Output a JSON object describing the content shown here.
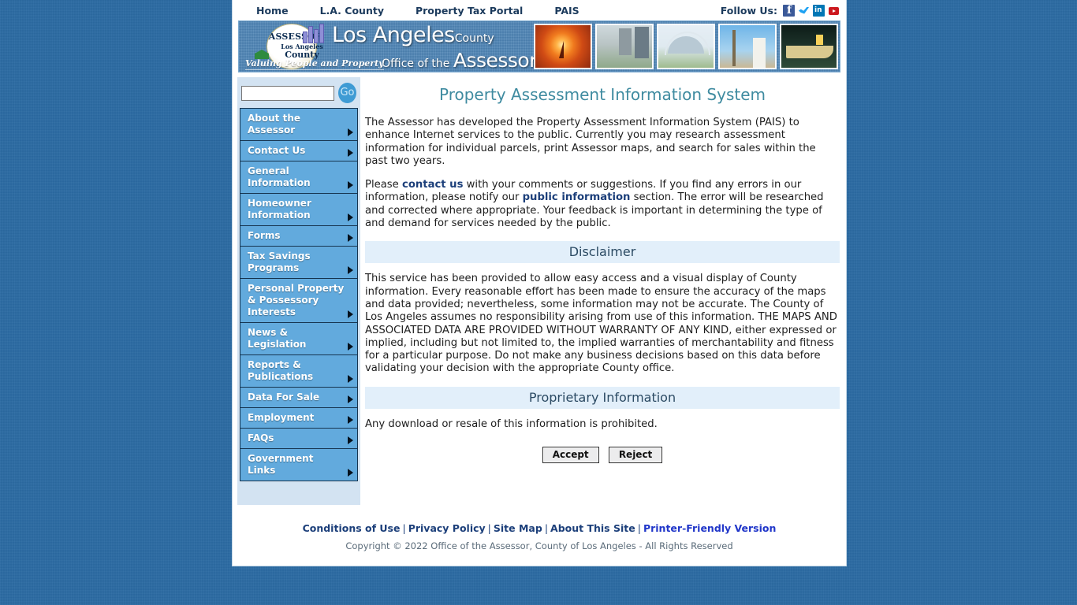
{
  "topnav": {
    "links": [
      {
        "label": "Home",
        "name": "topnav-home"
      },
      {
        "label": "L.A. County",
        "name": "topnav-la-county"
      },
      {
        "label": "Property Tax Portal",
        "name": "topnav-property-tax-portal"
      },
      {
        "label": "PAIS",
        "name": "topnav-pais"
      }
    ],
    "follow_label": "Follow Us:",
    "social": [
      {
        "name": "facebook-icon",
        "label": "Facebook"
      },
      {
        "name": "twitter-icon",
        "label": "Twitter"
      },
      {
        "name": "linkedin-icon",
        "label": "LinkedIn"
      },
      {
        "name": "youtube-icon",
        "label": "YouTube"
      }
    ]
  },
  "banner": {
    "logo_assessor": "ASSESSOR",
    "logo_la": "Los Angeles",
    "logo_county": "County",
    "tagline": "Valuing People and Property",
    "title_line1_main": "Los Angeles",
    "title_line1_small": "County",
    "title_line2_pre": "Office of the",
    "title_line2_big": "Assessor",
    "photos": [
      {
        "name": "photo-sunset-sailboat",
        "alt": "Sunset with sailboat"
      },
      {
        "name": "photo-civic-center",
        "alt": "Civic center buildings"
      },
      {
        "name": "photo-lax-theme-building",
        "alt": "LAX Theme Building"
      },
      {
        "name": "photo-palm-trees",
        "alt": "Palm trees and tower"
      },
      {
        "name": "photo-queen-mary",
        "alt": "Ship at night"
      }
    ]
  },
  "sidebar": {
    "search_value": "",
    "search_placeholder": "",
    "go_label": "Go",
    "menu": [
      {
        "label": "About the Assessor",
        "name": "sidebar-item-about-the-assessor"
      },
      {
        "label": "Contact Us",
        "name": "sidebar-item-contact-us"
      },
      {
        "label": "General Information",
        "name": "sidebar-item-general-information"
      },
      {
        "label": "Homeowner Information",
        "name": "sidebar-item-homeowner-information"
      },
      {
        "label": "Forms",
        "name": "sidebar-item-forms"
      },
      {
        "label": "Tax Savings Programs",
        "name": "sidebar-item-tax-savings-programs"
      },
      {
        "label": "Personal Property & Possessory Interests",
        "name": "sidebar-item-personal-property-possessory-interests"
      },
      {
        "label": "News & Legislation",
        "name": "sidebar-item-news-legislation"
      },
      {
        "label": "Reports & Publications",
        "name": "sidebar-item-reports-publications"
      },
      {
        "label": "Data For Sale",
        "name": "sidebar-item-data-for-sale"
      },
      {
        "label": "Employment",
        "name": "sidebar-item-employment"
      },
      {
        "label": "FAQs",
        "name": "sidebar-item-faqs"
      },
      {
        "label": "Government Links",
        "name": "sidebar-item-government-links"
      }
    ]
  },
  "main": {
    "title": "Property Assessment Information System",
    "intro": "The Assessor has developed the Property Assessment Information System (PAIS) to enhance Internet services to the public. Currently you may research assessment information for individual parcels, print Assessor maps, and search for sales within the past two years.",
    "feedback_part1": "Please ",
    "feedback_link1": "contact us",
    "feedback_part2": " with your comments or suggestions. If you find any errors in our information, please notify our ",
    "feedback_link2": "public information",
    "feedback_part3": " section. The error will be researched and corrected where appropriate. Your feedback is important in determining the type of and demand for services needed by the public.",
    "disclaimer_heading": "Disclaimer",
    "disclaimer_body": "This service has been provided to allow easy access and a visual display of County information. Every reasonable effort has been made to ensure the accuracy of the maps and data provided; nevertheless, some information may not be accurate. The County of Los Angeles assumes no responsibility arising from use of this information. THE MAPS AND ASSOCIATED DATA ARE PROVIDED WITHOUT WARRANTY OF ANY KIND, either expressed or implied, including but not limited to, the implied warranties of merchantability and fitness for a particular purpose. Do not make any business decisions based on this data before validating your decision with the appropriate County office.",
    "proprietary_heading": "Proprietary Information",
    "proprietary_body": "Any download or resale of this information is prohibited.",
    "accept_label": "Accept",
    "reject_label": "Reject"
  },
  "footer": {
    "links": [
      {
        "label": "Conditions of Use",
        "name": "footer-link-conditions-of-use",
        "highlight": false
      },
      {
        "label": "Privacy Policy",
        "name": "footer-link-privacy-policy",
        "highlight": false
      },
      {
        "label": "Site Map",
        "name": "footer-link-site-map",
        "highlight": false
      },
      {
        "label": "About This Site",
        "name": "footer-link-about-this-site",
        "highlight": false
      },
      {
        "label": "Printer-Friendly Version",
        "name": "footer-link-printer-friendly-version",
        "highlight": true
      }
    ],
    "separator": "|",
    "copyright": "Copyright © 2022 Office of the Assessor, County of Los Angeles - All Rights Reserved"
  },
  "colors": {
    "page_background": "#2c6ba3",
    "banner_blue": "#4e84b5",
    "menu_blue": "#62aadd",
    "sidebar_bg": "#d3e3f2",
    "title_teal": "#3f8ba0",
    "section_bar": "#e2effa",
    "link_navy": "#1c3f7a",
    "highlight_link": "#2036c9"
  }
}
